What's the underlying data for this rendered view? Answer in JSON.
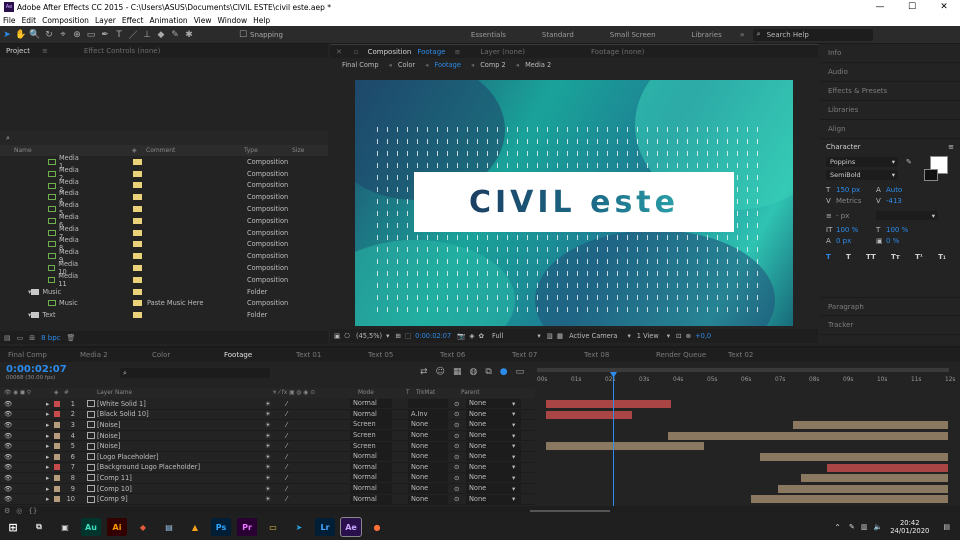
{
  "app": {
    "title": "Adobe After Effects CC 2015 - C:\\Users\\ASUS\\Documents\\CIVIL ESTE\\civil este.aep *",
    "logo": "Ae"
  },
  "menu": [
    "File",
    "Edit",
    "Composition",
    "Layer",
    "Effect",
    "Animation",
    "View",
    "Window",
    "Help"
  ],
  "toolbar": {
    "snapping": "Snapping",
    "workspaces": [
      "Essentials",
      "Standard",
      "Small Screen",
      "Libraries"
    ],
    "search_placeholder": "Search Help"
  },
  "project": {
    "tabs": [
      "Project",
      "Effect Controls (none)"
    ],
    "bpc": "8 bpc",
    "columns": {
      "name": "Name",
      "comment": "Comment",
      "type": "Type",
      "size": "Size"
    },
    "items": [
      {
        "name": "Media 1",
        "comment": "",
        "type": "Composition"
      },
      {
        "name": "Media 2",
        "comment": "",
        "type": "Composition"
      },
      {
        "name": "Media 3",
        "comment": "",
        "type": "Composition"
      },
      {
        "name": "Media 4",
        "comment": "",
        "type": "Composition"
      },
      {
        "name": "Media 5",
        "comment": "",
        "type": "Composition"
      },
      {
        "name": "Media 6",
        "comment": "",
        "type": "Composition"
      },
      {
        "name": "Media 7",
        "comment": "",
        "type": "Composition"
      },
      {
        "name": "Media 8",
        "comment": "",
        "type": "Composition"
      },
      {
        "name": "Media 9",
        "comment": "",
        "type": "Composition"
      },
      {
        "name": "Media 10",
        "comment": "",
        "type": "Composition"
      },
      {
        "name": "Media 11",
        "comment": "",
        "type": "Composition"
      },
      {
        "name": "Music",
        "comment": "",
        "type": "Folder",
        "folder": true
      },
      {
        "name": "Music",
        "comment": "Paste Music Here",
        "type": "Composition"
      },
      {
        "name": "Text",
        "comment": "",
        "type": "Folder",
        "folder": true
      }
    ]
  },
  "viewer": {
    "tabs": [
      "Composition",
      "Footage",
      "Layer (none)",
      "Footage (none)"
    ],
    "crumbs": [
      "Final Comp",
      "Color",
      "Footage",
      "Comp 2",
      "Media 2"
    ],
    "title_text": "CIVIL este",
    "zoom": "(45,5%)",
    "time": "0:00:02:07",
    "resolution": "Full",
    "camera": "Active Camera",
    "views": "1 View",
    "exposure": "+0,0"
  },
  "right": {
    "panels": [
      "Info",
      "Audio",
      "Effects & Presets",
      "Libraries",
      "Align"
    ],
    "character": "Character",
    "font": "Poppins",
    "style": "SemiBold",
    "size": "150 px",
    "leading": "Auto",
    "kerning": "Metrics",
    "tracking": "-413",
    "stroke_unit": "- px",
    "vscale": "100 %",
    "hscale": "100 %",
    "baseline": "0 px",
    "tsume": "0 %",
    "bottom_panels": [
      "Paragraph",
      "Tracker"
    ]
  },
  "timeline": {
    "tabs": [
      "Final Comp",
      "Media 2",
      "Color",
      "Footage",
      "Text 01",
      "Text 05",
      "Text 06",
      "Text 07",
      "Text 08",
      "Render Queue",
      "Text 02"
    ],
    "time": "0:00:02:07",
    "frames": "00068 (30.00 fps)",
    "headers": {
      "layer": "Layer Name",
      "mode": "Mode",
      "t": "T",
      "trkmat": "TrkMat",
      "parent": "Parent"
    },
    "ruler": [
      "00s",
      "01s",
      "02s",
      "03s",
      "04s",
      "05s",
      "06s",
      "07s",
      "08s",
      "09s",
      "10s",
      "11s",
      "12s"
    ],
    "layers": [
      {
        "num": "1",
        "name": "[White Solid 1]",
        "mode": "Normal",
        "trk": "",
        "parent": "None",
        "label": "#c84b4b"
      },
      {
        "num": "2",
        "name": "[Black Solid 10]",
        "mode": "Normal",
        "trk": "A.Inv",
        "parent": "None",
        "label": "#c84b4b"
      },
      {
        "num": "3",
        "name": "[Noise]",
        "mode": "Screen",
        "trk": "None",
        "parent": "None",
        "label": "#b59c7a"
      },
      {
        "num": "4",
        "name": "[Noise]",
        "mode": "Screen",
        "trk": "None",
        "parent": "None",
        "label": "#b59c7a"
      },
      {
        "num": "5",
        "name": "[Noise]",
        "mode": "Screen",
        "trk": "None",
        "parent": "None",
        "label": "#b59c7a"
      },
      {
        "num": "6",
        "name": "[Logo Placeholder]",
        "mode": "Normal",
        "trk": "None",
        "parent": "None",
        "label": "#b59c7a"
      },
      {
        "num": "7",
        "name": "[Background Logo Placeholder]",
        "mode": "Normal",
        "trk": "None",
        "parent": "None",
        "label": "#c84b4b"
      },
      {
        "num": "8",
        "name": "[Comp 11]",
        "mode": "Normal",
        "trk": "None",
        "parent": "None",
        "label": "#b59c7a"
      },
      {
        "num": "9",
        "name": "[Comp 10]",
        "mode": "Normal",
        "trk": "None",
        "parent": "None",
        "label": "#b59c7a"
      },
      {
        "num": "10",
        "name": "[Comp 9]",
        "mode": "Normal",
        "trk": "None",
        "parent": "None",
        "label": "#b59c7a"
      }
    ]
  },
  "taskbar": {
    "clock": "20:42",
    "date": "24/01/2020",
    "apps": [
      "Au",
      "Ai",
      "Ps",
      "Pr",
      "Lr",
      "Ae"
    ]
  }
}
